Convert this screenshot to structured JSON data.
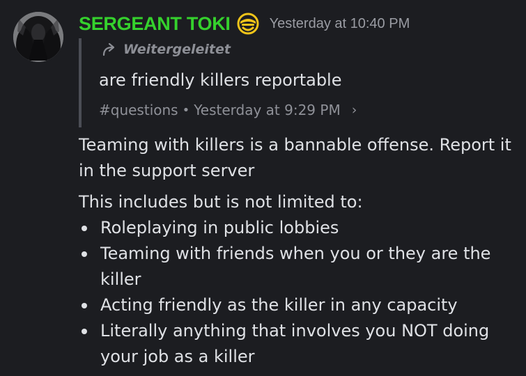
{
  "message": {
    "author": {
      "name": "SERGEANT TOKI",
      "name_color": "#35d12d",
      "avatar": "dark-hooded-figure-avatar",
      "badge_icon": "role-helmet-badge-icon",
      "badge_color": "#f0c419"
    },
    "timestamp": "Yesterday at 10:40 PM",
    "forwarded": {
      "label": "Weitergeleitet",
      "icon": "forward-arrow-icon",
      "content": "are friendly killers reportable",
      "channel": "#questions",
      "separator": "•",
      "time": "Yesterday at 9:29 PM",
      "chevron": "›"
    },
    "paragraphs": [
      "Teaming with killers is a bannable offense. Report it in the support server",
      "This includes but is not limited to:"
    ],
    "bullets": [
      "Roleplaying in public lobbies",
      "Teaming with friends when you or they are the killer",
      "Acting friendly as the killer in any capacity",
      "Literally anything that involves you NOT doing your job as a killer"
    ]
  }
}
